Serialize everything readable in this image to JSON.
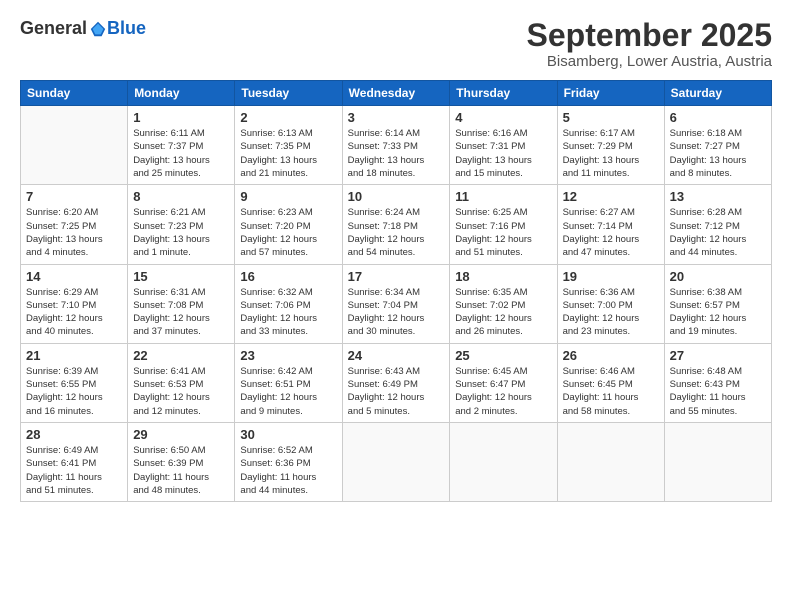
{
  "header": {
    "logo_general": "General",
    "logo_blue": "Blue",
    "month_title": "September 2025",
    "location": "Bisamberg, Lower Austria, Austria"
  },
  "days_of_week": [
    "Sunday",
    "Monday",
    "Tuesday",
    "Wednesday",
    "Thursday",
    "Friday",
    "Saturday"
  ],
  "weeks": [
    [
      {
        "day": "",
        "info": ""
      },
      {
        "day": "1",
        "info": "Sunrise: 6:11 AM\nSunset: 7:37 PM\nDaylight: 13 hours\nand 25 minutes."
      },
      {
        "day": "2",
        "info": "Sunrise: 6:13 AM\nSunset: 7:35 PM\nDaylight: 13 hours\nand 21 minutes."
      },
      {
        "day": "3",
        "info": "Sunrise: 6:14 AM\nSunset: 7:33 PM\nDaylight: 13 hours\nand 18 minutes."
      },
      {
        "day": "4",
        "info": "Sunrise: 6:16 AM\nSunset: 7:31 PM\nDaylight: 13 hours\nand 15 minutes."
      },
      {
        "day": "5",
        "info": "Sunrise: 6:17 AM\nSunset: 7:29 PM\nDaylight: 13 hours\nand 11 minutes."
      },
      {
        "day": "6",
        "info": "Sunrise: 6:18 AM\nSunset: 7:27 PM\nDaylight: 13 hours\nand 8 minutes."
      }
    ],
    [
      {
        "day": "7",
        "info": "Sunrise: 6:20 AM\nSunset: 7:25 PM\nDaylight: 13 hours\nand 4 minutes."
      },
      {
        "day": "8",
        "info": "Sunrise: 6:21 AM\nSunset: 7:23 PM\nDaylight: 13 hours\nand 1 minute."
      },
      {
        "day": "9",
        "info": "Sunrise: 6:23 AM\nSunset: 7:20 PM\nDaylight: 12 hours\nand 57 minutes."
      },
      {
        "day": "10",
        "info": "Sunrise: 6:24 AM\nSunset: 7:18 PM\nDaylight: 12 hours\nand 54 minutes."
      },
      {
        "day": "11",
        "info": "Sunrise: 6:25 AM\nSunset: 7:16 PM\nDaylight: 12 hours\nand 51 minutes."
      },
      {
        "day": "12",
        "info": "Sunrise: 6:27 AM\nSunset: 7:14 PM\nDaylight: 12 hours\nand 47 minutes."
      },
      {
        "day": "13",
        "info": "Sunrise: 6:28 AM\nSunset: 7:12 PM\nDaylight: 12 hours\nand 44 minutes."
      }
    ],
    [
      {
        "day": "14",
        "info": "Sunrise: 6:29 AM\nSunset: 7:10 PM\nDaylight: 12 hours\nand 40 minutes."
      },
      {
        "day": "15",
        "info": "Sunrise: 6:31 AM\nSunset: 7:08 PM\nDaylight: 12 hours\nand 37 minutes."
      },
      {
        "day": "16",
        "info": "Sunrise: 6:32 AM\nSunset: 7:06 PM\nDaylight: 12 hours\nand 33 minutes."
      },
      {
        "day": "17",
        "info": "Sunrise: 6:34 AM\nSunset: 7:04 PM\nDaylight: 12 hours\nand 30 minutes."
      },
      {
        "day": "18",
        "info": "Sunrise: 6:35 AM\nSunset: 7:02 PM\nDaylight: 12 hours\nand 26 minutes."
      },
      {
        "day": "19",
        "info": "Sunrise: 6:36 AM\nSunset: 7:00 PM\nDaylight: 12 hours\nand 23 minutes."
      },
      {
        "day": "20",
        "info": "Sunrise: 6:38 AM\nSunset: 6:57 PM\nDaylight: 12 hours\nand 19 minutes."
      }
    ],
    [
      {
        "day": "21",
        "info": "Sunrise: 6:39 AM\nSunset: 6:55 PM\nDaylight: 12 hours\nand 16 minutes."
      },
      {
        "day": "22",
        "info": "Sunrise: 6:41 AM\nSunset: 6:53 PM\nDaylight: 12 hours\nand 12 minutes."
      },
      {
        "day": "23",
        "info": "Sunrise: 6:42 AM\nSunset: 6:51 PM\nDaylight: 12 hours\nand 9 minutes."
      },
      {
        "day": "24",
        "info": "Sunrise: 6:43 AM\nSunset: 6:49 PM\nDaylight: 12 hours\nand 5 minutes."
      },
      {
        "day": "25",
        "info": "Sunrise: 6:45 AM\nSunset: 6:47 PM\nDaylight: 12 hours\nand 2 minutes."
      },
      {
        "day": "26",
        "info": "Sunrise: 6:46 AM\nSunset: 6:45 PM\nDaylight: 11 hours\nand 58 minutes."
      },
      {
        "day": "27",
        "info": "Sunrise: 6:48 AM\nSunset: 6:43 PM\nDaylight: 11 hours\nand 55 minutes."
      }
    ],
    [
      {
        "day": "28",
        "info": "Sunrise: 6:49 AM\nSunset: 6:41 PM\nDaylight: 11 hours\nand 51 minutes."
      },
      {
        "day": "29",
        "info": "Sunrise: 6:50 AM\nSunset: 6:39 PM\nDaylight: 11 hours\nand 48 minutes."
      },
      {
        "day": "30",
        "info": "Sunrise: 6:52 AM\nSunset: 6:36 PM\nDaylight: 11 hours\nand 44 minutes."
      },
      {
        "day": "",
        "info": ""
      },
      {
        "day": "",
        "info": ""
      },
      {
        "day": "",
        "info": ""
      },
      {
        "day": "",
        "info": ""
      }
    ]
  ]
}
